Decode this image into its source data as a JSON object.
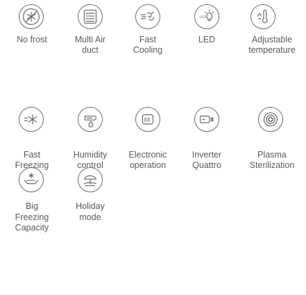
{
  "features": {
    "no_frost": {
      "label": "No frost",
      "icon": "no-frost-icon"
    },
    "multi_air_duct": {
      "label": "Multi Air\nduct",
      "icon": "air-duct-icon"
    },
    "fast_cooling": {
      "label": "Fast\nCooling",
      "icon": "fast-cooling-icon"
    },
    "led": {
      "label": "LED",
      "icon": "led-bulb-icon",
      "icon_text": "LED"
    },
    "adjustable_temperature": {
      "label": "Adjustable\ntemperature",
      "icon": "thermometer-icon"
    },
    "fast_freezing": {
      "label": "Fast\nFreezing",
      "icon": "fast-freezing-icon"
    },
    "humidity_control": {
      "label": "Humidity\ncontrol",
      "icon": "humidity-icon"
    },
    "electronic_operation": {
      "label": "Electronic\noperation",
      "icon": "electronic-display-icon",
      "icon_text": "88"
    },
    "inverter_quattro": {
      "label": "Inverter\nQuattro",
      "icon": "inverter-icon"
    },
    "plasma_sterilization": {
      "label": "Plasma\nSterilization",
      "icon": "plasma-icon"
    },
    "big_freezing_capacity": {
      "label": "Big\nFreezing\nCapacity",
      "icon": "freezer-drawer-icon"
    },
    "holiday_mode": {
      "label": "Holiday\nmode",
      "icon": "holiday-icon"
    }
  },
  "colors": {
    "stroke": "#6b6b6b",
    "text": "#5a5a5a",
    "background": "#ffffff"
  }
}
